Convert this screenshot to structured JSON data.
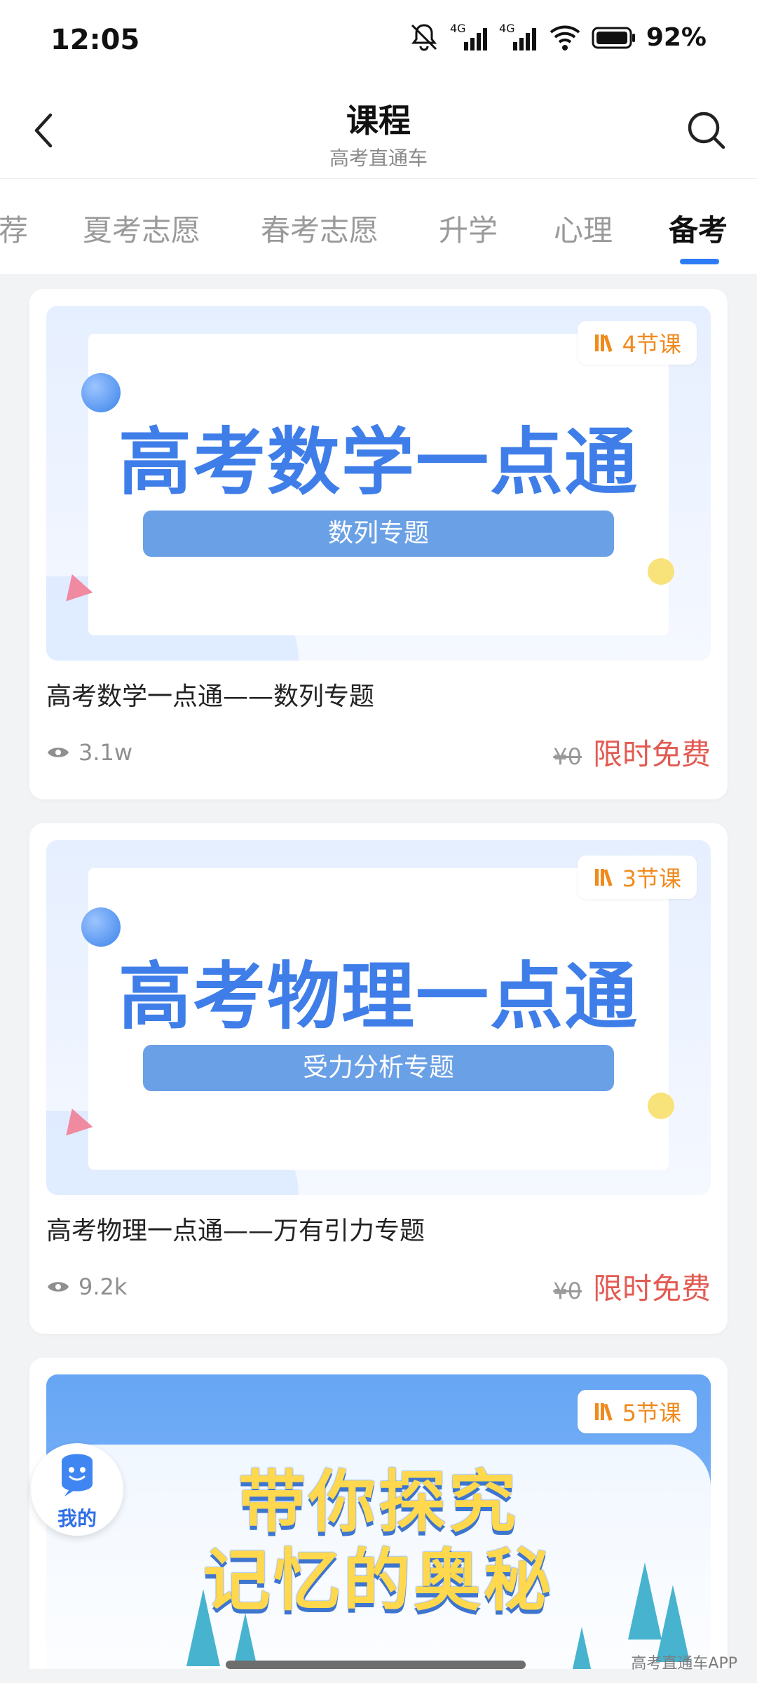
{
  "status_bar": {
    "time": "12:05",
    "battery": "92%",
    "network_1": "4G",
    "network_2": "4G",
    "icons": [
      "mute-bell-icon",
      "signal-icon",
      "signal-icon",
      "wifi-icon",
      "battery-icon"
    ]
  },
  "header": {
    "title": "课程",
    "subtitle": "高考直通车",
    "back_icon": "chevron-left-icon",
    "search_icon": "search-icon"
  },
  "tabs": [
    {
      "label": "荐"
    },
    {
      "label": "夏考志愿"
    },
    {
      "label": "春考志愿"
    },
    {
      "label": "升学"
    },
    {
      "label": "心理"
    },
    {
      "label": "备考",
      "active": true
    }
  ],
  "courses": [
    {
      "thumb_title": "高考数学一点通",
      "thumb_bar": "数列专题",
      "lessons": "4节课",
      "title": "高考数学一点通——数列专题",
      "views": "3.1w",
      "price_old": "¥0",
      "price_label": "限时免费"
    },
    {
      "thumb_title": "高考物理一点通",
      "thumb_bar": "受力分析专题",
      "lessons": "3节课",
      "title": "高考物理一点通——万有引力专题",
      "views": "9.2k",
      "price_old": "¥0",
      "price_label": "限时免费"
    },
    {
      "thumb_title_line1": "带你探究",
      "thumb_title_line2": "记忆的奥秘",
      "lessons": "5节课"
    }
  ],
  "fab": {
    "label": "我的",
    "icon": "smiley-mascot-icon"
  },
  "watermark": "高考直通车APP",
  "colors": {
    "accent": "#2c7cf6",
    "price": "#e25b53",
    "badge": "#f08a1c"
  }
}
